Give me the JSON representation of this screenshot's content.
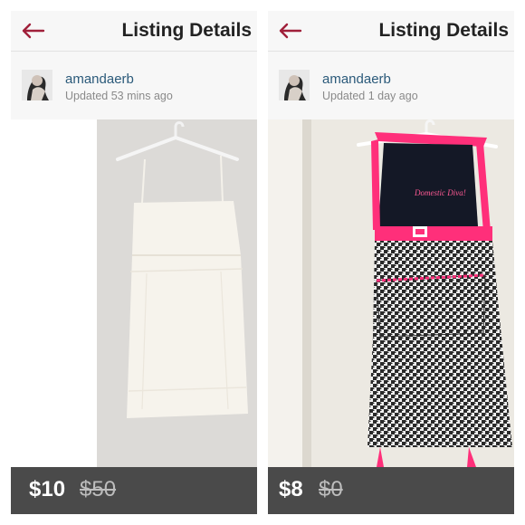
{
  "listings": [
    {
      "header_title": "Listing Details",
      "username": "amandaerb",
      "updated": "Updated 53 mins ago",
      "price": "$10",
      "original_price": "$50",
      "photo_subject": "white-dress-on-hanger"
    },
    {
      "header_title": "Listing Details",
      "username": "amandaerb",
      "updated": "Updated 1 day ago",
      "price": "$8",
      "original_price": "$0",
      "photo_subject": "houndstooth-apron-on-hanger",
      "apron_text": "Domestic Diva!"
    }
  ],
  "colors": {
    "back_arrow": "#a0203a",
    "price_bar": "#4a4a4a",
    "apron_pink": "#ff2f7a",
    "username": "#2b5a7a"
  }
}
